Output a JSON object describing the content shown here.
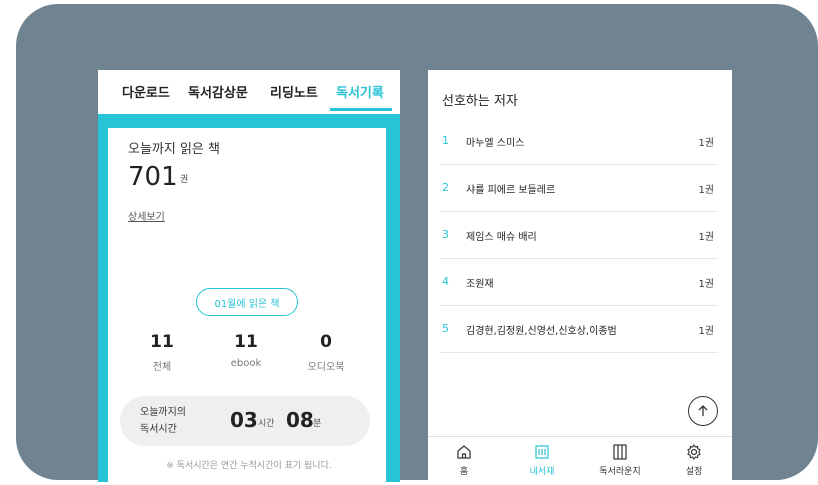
{
  "left": {
    "tabs": [
      "다운로드",
      "독서감상문",
      "리딩노트",
      "독서기록"
    ],
    "active_tab_index": 3,
    "today_label": "오늘까지 읽은 책",
    "total_books": "701",
    "unit_book": "권",
    "detail_link": "상세보기",
    "month_button": "01월에 읽은 책",
    "stats": [
      {
        "value": "11",
        "label": "전체"
      },
      {
        "value": "11",
        "label": "ebook"
      },
      {
        "value": "0",
        "label": "오디오북"
      }
    ],
    "reading_time": {
      "label_line1": "오늘까지의",
      "label_line2": "독서시간",
      "hours": "03",
      "hours_unit": "시간",
      "minutes": "08",
      "minutes_unit": "분"
    },
    "note": "※ 독서시간은 연간 누적시간이 표기 됩니다."
  },
  "right": {
    "title": "선호하는 저자",
    "authors": [
      {
        "rank": "1",
        "name": "마누엘 스미스",
        "count": "1권"
      },
      {
        "rank": "2",
        "name": "샤를 피에르 보들레르",
        "count": "1권"
      },
      {
        "rank": "3",
        "name": "제임스 매슈 배리",
        "count": "1권"
      },
      {
        "rank": "4",
        "name": "조원재",
        "count": "1권"
      },
      {
        "rank": "5",
        "name": "김경현,김정원,신영선,신호상,이종범",
        "count": "1권"
      }
    ],
    "nav": [
      {
        "label": "홈",
        "icon": "home-icon"
      },
      {
        "label": "내서재",
        "icon": "bookshelf-icon"
      },
      {
        "label": "독서라운지",
        "icon": "lounge-icon"
      },
      {
        "label": "설정",
        "icon": "gear-icon"
      }
    ],
    "active_nav_index": 1
  },
  "colors": {
    "accent": "#28c3d4",
    "background": "#6f8490",
    "pill_bg": "#efefef"
  }
}
